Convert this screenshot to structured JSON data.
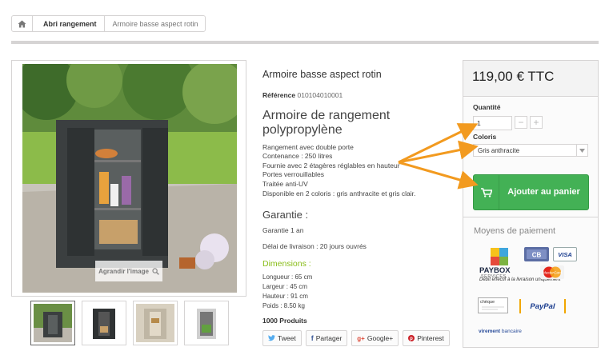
{
  "breadcrumb": {
    "home_icon": "home-icon",
    "category": "Abri rangement",
    "current": "Armoire basse aspect rotin"
  },
  "gallery": {
    "enlarge_label": "Agrandir l'image",
    "thumbnail_count": 4
  },
  "product": {
    "title": "Armoire basse aspect rotin",
    "reference_label": "Référence",
    "reference_value": "010104010001",
    "heading": "Armoire de rangement polypropylène",
    "description": [
      "Rangement avec double porte",
      "Contenance : 250 litres",
      "Fournie avec 2 étagères réglables en hauteur",
      "Portes verrouillables",
      "Traitée anti-UV",
      "Disponible en 2 coloris : gris anthracite et gris clair."
    ],
    "warranty_title": "Garantie :",
    "warranty_text": "Garantie 1 an",
    "delivery_text": "Délai de livraison : 20 jours ouvrés",
    "dimensions_title": "Dimensions :",
    "dimensions": [
      "Longueur : 65 cm",
      "Largeur : 45 cm",
      "Hauteur : 91 cm",
      "Poids : 8.50 kg"
    ],
    "stock": "1000 Produits"
  },
  "share": {
    "tweet": "Tweet",
    "facebook": "Partager",
    "google": "Google+",
    "pinterest": "Pinterest"
  },
  "buy_box": {
    "price": "119,00 € TTC",
    "quantity_label": "Quantité",
    "quantity_value": "1",
    "minus": "−",
    "plus": "+",
    "color_label": "Coloris",
    "color_value": "Gris anthracite",
    "add_to_cart": "Ajouter au panier",
    "payment_title": "Moyens de paiement",
    "paybox_name": "PAYBOX",
    "paybox_services": "SERVICES",
    "paybox_note": "Débit effectif à la livraison uniquement",
    "visa": "VISA",
    "mastercard": "MasterCard",
    "cheque": "chèque",
    "paypal": "PayPal",
    "virement": "virement",
    "bancaire": "bancaire"
  },
  "colors": {
    "accent_green": "#43b155",
    "dimension_green": "#89bd19",
    "arrow_orange": "#f29a1f"
  }
}
